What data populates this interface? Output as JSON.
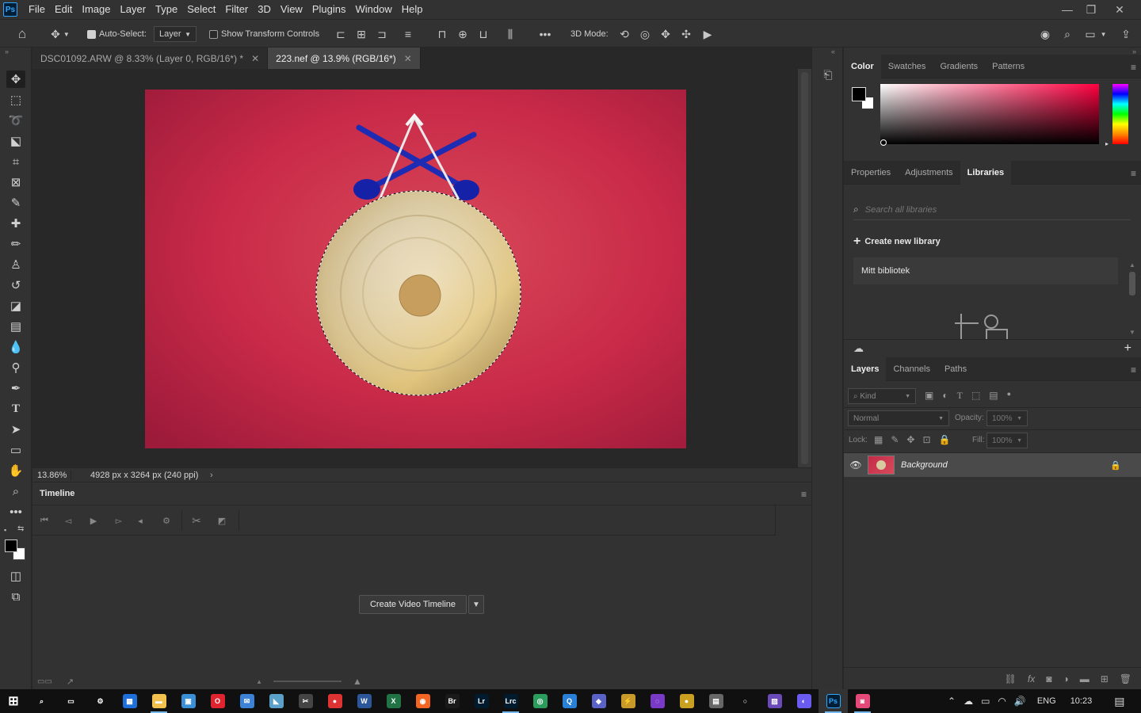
{
  "app": {
    "logo": "Ps"
  },
  "menubar": {
    "items": [
      "File",
      "Edit",
      "Image",
      "Layer",
      "Type",
      "Select",
      "Filter",
      "3D",
      "View",
      "Plugins",
      "Window",
      "Help"
    ]
  },
  "options": {
    "auto_select_label": "Auto-Select:",
    "auto_select_checked": true,
    "layer_dropdown": "Layer",
    "transform_label": "Show Transform Controls",
    "transform_checked": false,
    "mode_3d_label": "3D Mode:",
    "more_label": "•••"
  },
  "tabs": [
    {
      "label": "DSC01092.ARW @ 8.33% (Layer 0, RGB/16*) *",
      "active": false
    },
    {
      "label": "223.nef @ 13.9% (RGB/16*)",
      "active": true
    }
  ],
  "status": {
    "zoom": "13.86%",
    "doc_info": "4928 px x 3264 px (240 ppi)"
  },
  "timeline": {
    "title": "Timeline",
    "create_button": "Create Video Timeline"
  },
  "color_panel": {
    "tabs": [
      "Color",
      "Swatches",
      "Gradients",
      "Patterns"
    ],
    "active": "Color",
    "foreground": "#000000",
    "background": "#ffffff",
    "hue": "#ff0040"
  },
  "libraries_panel": {
    "tabs": [
      "Properties",
      "Adjustments",
      "Libraries"
    ],
    "active": "Libraries",
    "search_placeholder": "Search all libraries",
    "create_label": "Create new library",
    "library_name": "Mitt bibliotek"
  },
  "layers_panel": {
    "tabs": [
      "Layers",
      "Channels",
      "Paths"
    ],
    "active": "Layers",
    "filter_kind": "Kind",
    "blend_mode": "Normal",
    "opacity_label": "Opacity:",
    "opacity_value": "100%",
    "lock_label": "Lock:",
    "fill_label": "Fill:",
    "fill_value": "100%",
    "layers": [
      {
        "name": "Background",
        "visible": true,
        "locked": true
      }
    ]
  },
  "taskbar": {
    "language": "ENG",
    "time": "10:23",
    "apps": [
      {
        "name": "search",
        "color": "#101010",
        "label": "⌕"
      },
      {
        "name": "task-view",
        "color": "#101010",
        "label": "▭"
      },
      {
        "name": "settings",
        "color": "#101010",
        "label": "⚙"
      },
      {
        "name": "calendar",
        "color": "#1e6fd9",
        "label": "▦"
      },
      {
        "name": "explorer",
        "color": "#f2c14e",
        "label": "▬"
      },
      {
        "name": "remote",
        "color": "#3b8fd6",
        "label": "▣"
      },
      {
        "name": "opera",
        "color": "#e0242f",
        "label": "O"
      },
      {
        "name": "mail",
        "color": "#3c82d6",
        "label": "✉"
      },
      {
        "name": "app-shark",
        "color": "#5aa0c8",
        "label": "◣"
      },
      {
        "name": "capture",
        "color": "#444",
        "label": "✂"
      },
      {
        "name": "app-red",
        "color": "#d33",
        "label": "●"
      },
      {
        "name": "word",
        "color": "#2b579a",
        "label": "W"
      },
      {
        "name": "excel",
        "color": "#217346",
        "label": "X"
      },
      {
        "name": "app-orange",
        "color": "#f26522",
        "label": "◉"
      },
      {
        "name": "bridge",
        "color": "#1a1a1a",
        "label": "Br"
      },
      {
        "name": "lightroom",
        "color": "#001a2e",
        "label": "Lr"
      },
      {
        "name": "lightroom-cc",
        "color": "#001a2e",
        "label": "Lrc"
      },
      {
        "name": "app-green",
        "color": "#2a9d5c",
        "label": "◎"
      },
      {
        "name": "app-blue",
        "color": "#2a7fd6",
        "label": "Q"
      },
      {
        "name": "app-purple",
        "color": "#5a62c8",
        "label": "◆"
      },
      {
        "name": "app-bolt",
        "color": "#c89a2a",
        "label": "⚡"
      },
      {
        "name": "app-violet",
        "color": "#7a3ac8",
        "label": "◌"
      },
      {
        "name": "app-globe",
        "color": "#caa020",
        "label": "●"
      },
      {
        "name": "app-doc",
        "color": "#666",
        "label": "▤"
      },
      {
        "name": "cortana",
        "color": "#101010",
        "label": "○"
      },
      {
        "name": "app-img",
        "color": "#6a4ab8",
        "label": "▨"
      },
      {
        "name": "messenger",
        "color": "#6a5cf0",
        "label": "◐"
      },
      {
        "name": "photoshop",
        "color": "#001e36",
        "label": "Ps"
      },
      {
        "name": "app-camera",
        "color": "#e34a7a",
        "label": "◙"
      }
    ]
  }
}
